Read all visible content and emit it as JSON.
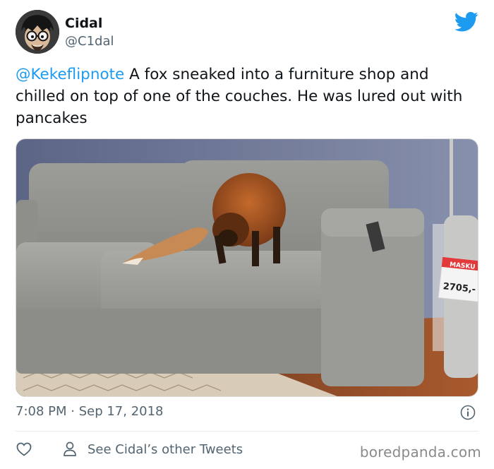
{
  "author": {
    "name": "Cidal",
    "handle": "@C1dal"
  },
  "tweet": {
    "mention": "@Kekeflipnote",
    "text": " A fox sneaked into a furniture shop and chilled on top of one of the couches. He was lured out with pancakes"
  },
  "photo": {
    "price_tag_label": "MASKU",
    "price_tag_price": "2705,-"
  },
  "meta": {
    "timestamp": "7:08 PM · Sep 17, 2018"
  },
  "actions": {
    "other_tweets_label": "See Cidal’s other Tweets"
  },
  "watermark": "boredpanda.com",
  "icons": [
    "bird-logo-icon",
    "info-icon",
    "heart-icon",
    "person-icon"
  ],
  "colors": {
    "link": "#1d9bf0",
    "secondary_text": "#536471",
    "twitter_blue": "#1d9bf0"
  }
}
